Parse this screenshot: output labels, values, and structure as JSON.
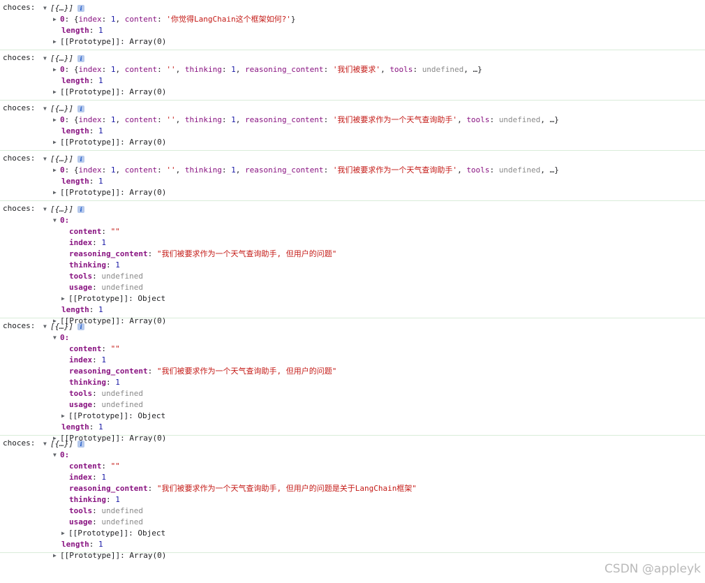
{
  "label": "choces:",
  "summary": "[{…}]",
  "info_icon": "info-icon",
  "proto_array": "[[Prototype]]: Array(0)",
  "proto_object": "[[Prototype]]: Object",
  "length_key": "length",
  "length_value": "1",
  "entries": [
    {
      "mode": "collapsed",
      "item": [
        {
          "t": "key",
          "v": "0"
        },
        {
          "t": "p",
          "v": ": {"
        },
        {
          "t": "pkey",
          "v": "index"
        },
        {
          "t": "p",
          "v": ": "
        },
        {
          "t": "num",
          "v": "1"
        },
        {
          "t": "p",
          "v": ", "
        },
        {
          "t": "pkey",
          "v": "content"
        },
        {
          "t": "p",
          "v": ": "
        },
        {
          "t": "str",
          "v": "'你觉得LangChain这个框架如何?'"
        },
        {
          "t": "p",
          "v": "}"
        }
      ]
    },
    {
      "mode": "collapsed",
      "item": [
        {
          "t": "key",
          "v": "0"
        },
        {
          "t": "p",
          "v": ": {"
        },
        {
          "t": "pkey",
          "v": "index"
        },
        {
          "t": "p",
          "v": ": "
        },
        {
          "t": "num",
          "v": "1"
        },
        {
          "t": "p",
          "v": ", "
        },
        {
          "t": "pkey",
          "v": "content"
        },
        {
          "t": "p",
          "v": ": "
        },
        {
          "t": "str",
          "v": "''"
        },
        {
          "t": "p",
          "v": ", "
        },
        {
          "t": "pkey",
          "v": "thinking"
        },
        {
          "t": "p",
          "v": ": "
        },
        {
          "t": "num",
          "v": "1"
        },
        {
          "t": "p",
          "v": ", "
        },
        {
          "t": "pkey",
          "v": "reasoning_content"
        },
        {
          "t": "p",
          "v": ": "
        },
        {
          "t": "str",
          "v": "'我们被要求'"
        },
        {
          "t": "p",
          "v": ", "
        },
        {
          "t": "pkey",
          "v": "tools"
        },
        {
          "t": "p",
          "v": ": "
        },
        {
          "t": "undef",
          "v": "undefined"
        },
        {
          "t": "p",
          "v": ", …}"
        }
      ]
    },
    {
      "mode": "collapsed",
      "item": [
        {
          "t": "key",
          "v": "0"
        },
        {
          "t": "p",
          "v": ": {"
        },
        {
          "t": "pkey",
          "v": "index"
        },
        {
          "t": "p",
          "v": ": "
        },
        {
          "t": "num",
          "v": "1"
        },
        {
          "t": "p",
          "v": ", "
        },
        {
          "t": "pkey",
          "v": "content"
        },
        {
          "t": "p",
          "v": ": "
        },
        {
          "t": "str",
          "v": "''"
        },
        {
          "t": "p",
          "v": ", "
        },
        {
          "t": "pkey",
          "v": "thinking"
        },
        {
          "t": "p",
          "v": ": "
        },
        {
          "t": "num",
          "v": "1"
        },
        {
          "t": "p",
          "v": ", "
        },
        {
          "t": "pkey",
          "v": "reasoning_content"
        },
        {
          "t": "p",
          "v": ": "
        },
        {
          "t": "str",
          "v": "'我们被要求作为一个天气查询助手'"
        },
        {
          "t": "p",
          "v": ", "
        },
        {
          "t": "pkey",
          "v": "tools"
        },
        {
          "t": "p",
          "v": ": "
        },
        {
          "t": "undef",
          "v": "undefined"
        },
        {
          "t": "p",
          "v": ", …}"
        }
      ]
    },
    {
      "mode": "collapsed",
      "item": [
        {
          "t": "key",
          "v": "0"
        },
        {
          "t": "p",
          "v": ": {"
        },
        {
          "t": "pkey",
          "v": "index"
        },
        {
          "t": "p",
          "v": ": "
        },
        {
          "t": "num",
          "v": "1"
        },
        {
          "t": "p",
          "v": ", "
        },
        {
          "t": "pkey",
          "v": "content"
        },
        {
          "t": "p",
          "v": ": "
        },
        {
          "t": "str",
          "v": "''"
        },
        {
          "t": "p",
          "v": ", "
        },
        {
          "t": "pkey",
          "v": "thinking"
        },
        {
          "t": "p",
          "v": ": "
        },
        {
          "t": "num",
          "v": "1"
        },
        {
          "t": "p",
          "v": ", "
        },
        {
          "t": "pkey",
          "v": "reasoning_content"
        },
        {
          "t": "p",
          "v": ": "
        },
        {
          "t": "str",
          "v": "'我们被要求作为一个天气查询助手'"
        },
        {
          "t": "p",
          "v": ", "
        },
        {
          "t": "pkey",
          "v": "tools"
        },
        {
          "t": "p",
          "v": ": "
        },
        {
          "t": "undef",
          "v": "undefined"
        },
        {
          "t": "p",
          "v": ", …}"
        }
      ]
    },
    {
      "mode": "expanded",
      "index_label": "0:",
      "props": [
        {
          "k": "content",
          "t": "str",
          "v": "\"\""
        },
        {
          "k": "index",
          "t": "num",
          "v": "1"
        },
        {
          "k": "reasoning_content",
          "t": "str",
          "v": "\"我们被要求作为一个天气查询助手, 但用户的问题\""
        },
        {
          "k": "thinking",
          "t": "num",
          "v": "1"
        },
        {
          "k": "tools",
          "t": "undef",
          "v": "undefined"
        },
        {
          "k": "usage",
          "t": "undef",
          "v": "undefined"
        }
      ]
    },
    {
      "mode": "expanded",
      "index_label": "0:",
      "props": [
        {
          "k": "content",
          "t": "str",
          "v": "\"\""
        },
        {
          "k": "index",
          "t": "num",
          "v": "1"
        },
        {
          "k": "reasoning_content",
          "t": "str",
          "v": "\"我们被要求作为一个天气查询助手, 但用户的问题\""
        },
        {
          "k": "thinking",
          "t": "num",
          "v": "1"
        },
        {
          "k": "tools",
          "t": "undef",
          "v": "undefined"
        },
        {
          "k": "usage",
          "t": "undef",
          "v": "undefined"
        }
      ]
    },
    {
      "mode": "expanded",
      "index_label": "0:",
      "props": [
        {
          "k": "content",
          "t": "str",
          "v": "\"\""
        },
        {
          "k": "index",
          "t": "num",
          "v": "1"
        },
        {
          "k": "reasoning_content",
          "t": "str",
          "v": "\"我们被要求作为一个天气查询助手, 但用户的问题是关于LangChain框架\""
        },
        {
          "k": "thinking",
          "t": "num",
          "v": "1"
        },
        {
          "k": "tools",
          "t": "undef",
          "v": "undefined"
        },
        {
          "k": "usage",
          "t": "undef",
          "v": "undefined"
        }
      ]
    }
  ],
  "watermark": "CSDN @appleyk"
}
